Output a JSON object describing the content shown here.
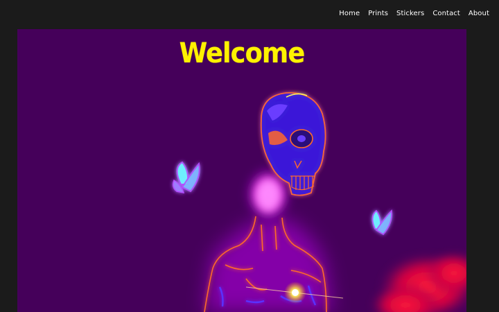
{
  "nav": {
    "items": [
      {
        "label": "Home"
      },
      {
        "label": "Prints"
      },
      {
        "label": "Stickers"
      },
      {
        "label": "Contact"
      },
      {
        "label": "About"
      }
    ]
  },
  "hero": {
    "title": "Welcome"
  },
  "colors": {
    "page_background": "#1b1b1b",
    "hero_background": "#45005a",
    "title": "#fff200",
    "nav_text": "#ffffff",
    "neon_orange": "#ff6a2a",
    "neon_magenta": "#ff2bd6",
    "neon_blue": "#5a33ff",
    "butterfly_cyan": "#6ff0ff"
  }
}
